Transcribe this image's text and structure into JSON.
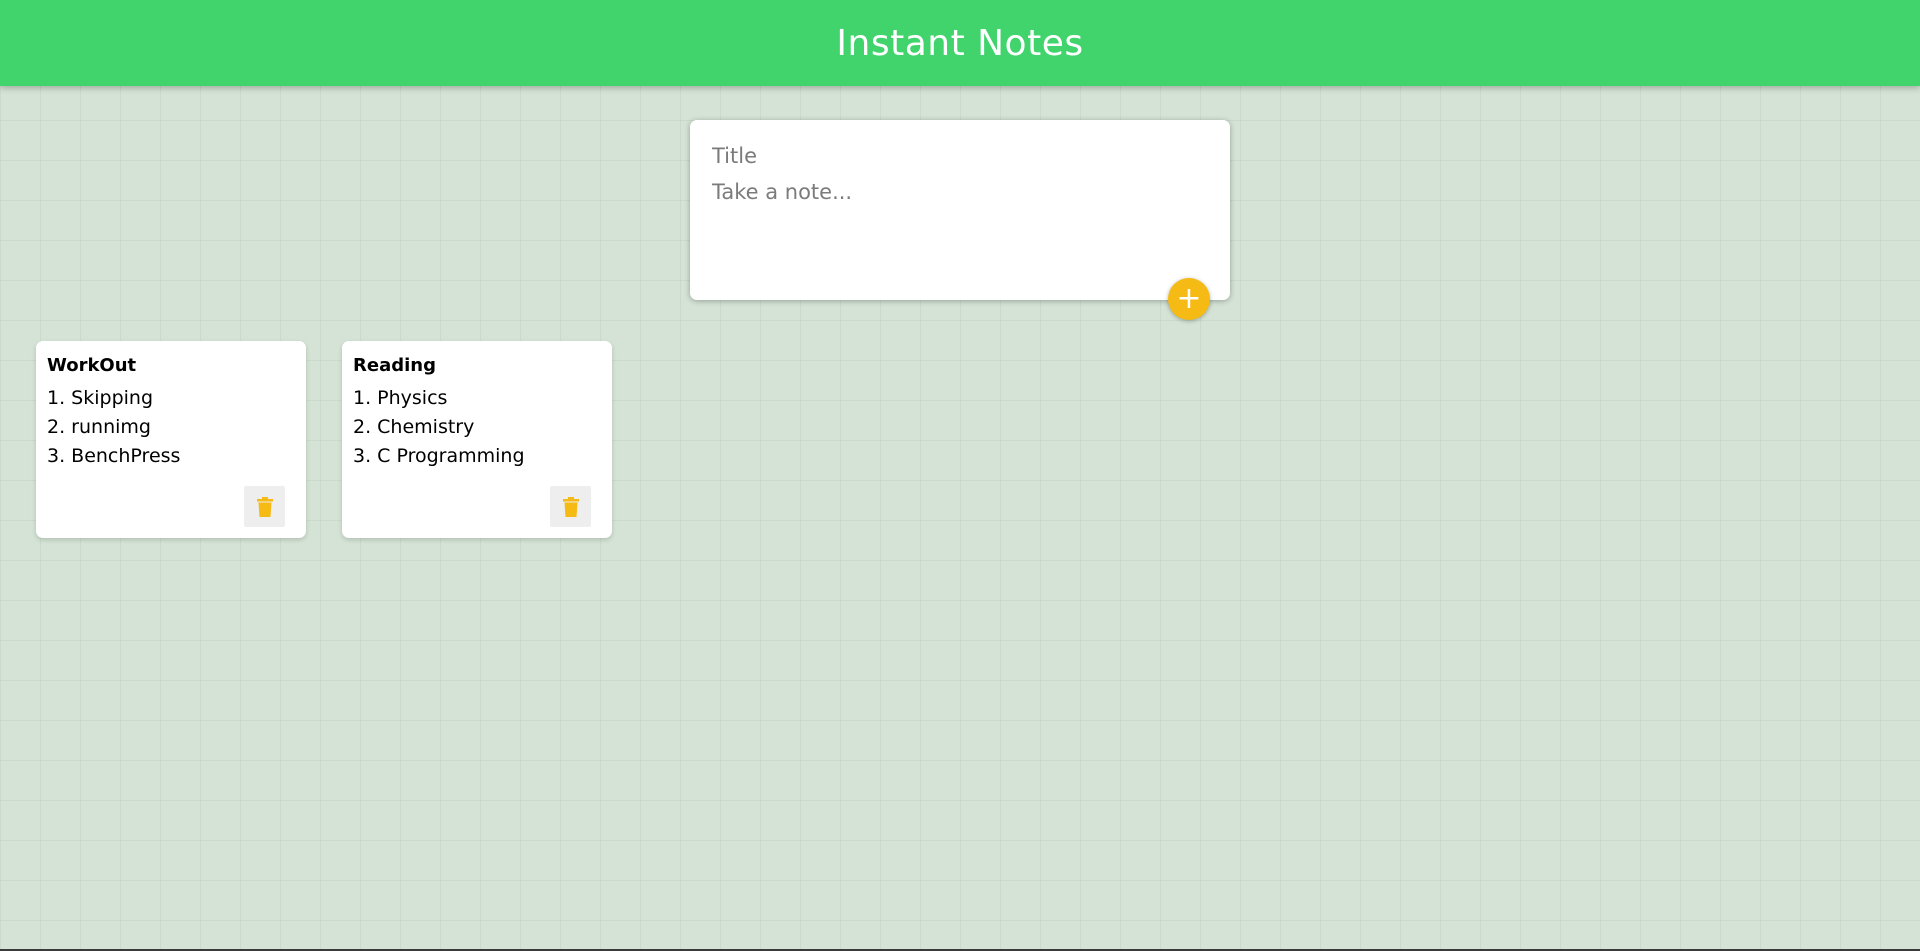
{
  "app": {
    "title": "Instant Notes"
  },
  "composer": {
    "title_placeholder": "Title",
    "content_placeholder": "Take a note...",
    "add_label": "+"
  },
  "notes": [
    {
      "title": "WorkOut",
      "lines": [
        "1. Skipping",
        "2. runnimg",
        "3. BenchPress"
      ]
    },
    {
      "title": "Reading",
      "lines": [
        "1. Physics",
        "2. Chemistry",
        "3. C Programming"
      ]
    }
  ],
  "icons": {
    "add": "plus-icon",
    "delete": "trash-icon"
  },
  "colors": {
    "header": "#41d46d",
    "background": "#d4e3d5",
    "accent": "#f5ba13"
  }
}
